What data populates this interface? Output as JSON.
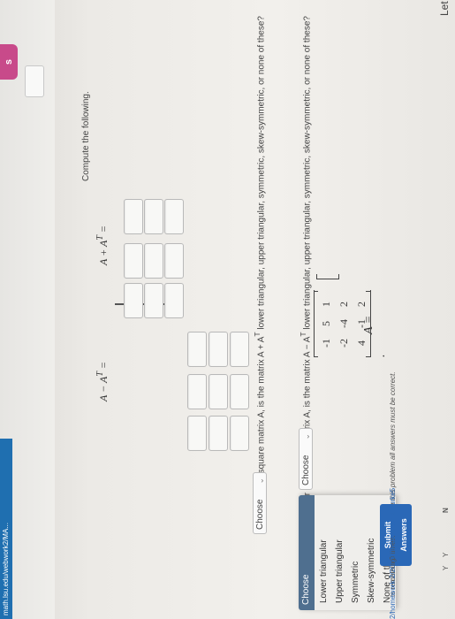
{
  "browser": {
    "tab_badge": "s",
    "url_text": "math.lsu.edu/webwork2/MA..."
  },
  "problem": {
    "intro": "Let",
    "matrix_symbol": "A =",
    "matrix": [
      [
        "1",
        "2",
        "2"
      ],
      [
        "5",
        "-4",
        "-1"
      ],
      [
        "-1",
        "-2",
        "4"
      ]
    ],
    "matrix_end": ".",
    "compute": "Compute the following.",
    "sum_label": "A + A",
    "diff_label": "A − A",
    "transpose_sup": "T",
    "equals": "=",
    "q1": "For any square matrix A, is the matrix A + A",
    "q1_tail": " lower triangular, upper triangular, symmetric, skew-symmetric, or none of these?",
    "q2": "For any square matrix A, is the matrix A − A",
    "q2_tail": " lower triangular, upper triangular, symmetric, skew-symmetric, or none of these?",
    "select_value_1": "Choose",
    "select_value_2": "Choose"
  },
  "dropdown": {
    "header": "Choose",
    "options": [
      "Lower triangular",
      "Upper triangular",
      "Symmetric",
      "Skew-symmetric",
      "None of these"
    ]
  },
  "footer": {
    "note": "For this problem all answers must be correct.",
    "submit_label": "Submit Answers",
    "attempts": "roblem 0 times.",
    "remaining": "ts remaining.",
    "left_letters": [
      "N",
      "Y",
      "Y"
    ],
    "url_hint": "2/homework 2/20/?effectiveUser=bburke5"
  }
}
